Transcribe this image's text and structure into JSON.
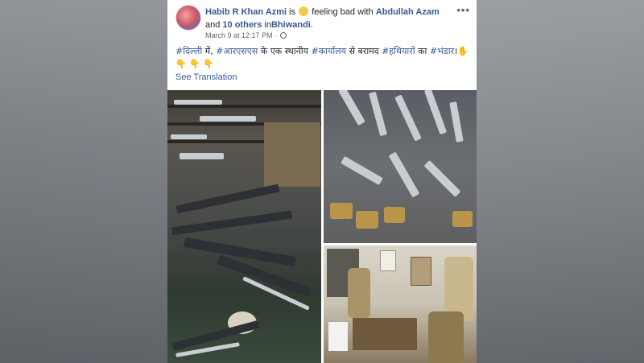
{
  "post": {
    "author": "Habib R Khan Azmi",
    "is_text": "is",
    "feeling": "feeling bad with",
    "tagged": "Abdullah Azam",
    "and_text": "and",
    "others": "10 others",
    "in_text": "in",
    "place": "Bhiwandi",
    "period": ".",
    "date": "March 9 at 12:17 PM",
    "dot": "·",
    "more": "•••",
    "text_parts": [
      {
        "kind": "tag",
        "text": "#दिल्ली"
      },
      {
        "kind": "plain",
        "text": " में, "
      },
      {
        "kind": "tag",
        "text": "#आरएसएस"
      },
      {
        "kind": "plain",
        "text": " के एक स्थानीय "
      },
      {
        "kind": "tag",
        "text": "#कार्यालय"
      },
      {
        "kind": "plain",
        "text": " से बरामद "
      },
      {
        "kind": "tag",
        "text": "#हथियारों"
      },
      {
        "kind": "plain",
        "text": " का "
      },
      {
        "kind": "tag",
        "text": "#भंडार"
      },
      {
        "kind": "plain",
        "text": "।"
      }
    ],
    "see_translation": "See Translation"
  },
  "colors": {
    "link": "#385898",
    "tag": "#365899",
    "text": "#1d2129",
    "meta": "#616770"
  },
  "icons": [
    "worried-face-emoji",
    "pointing-hand-emoji",
    "globe-icon",
    "more-options-icon"
  ],
  "photos": [
    {
      "id": "weapons-stockpile-floor"
    },
    {
      "id": "knives-and-brass-knuckles"
    },
    {
      "id": "police-officers-in-office"
    }
  ]
}
